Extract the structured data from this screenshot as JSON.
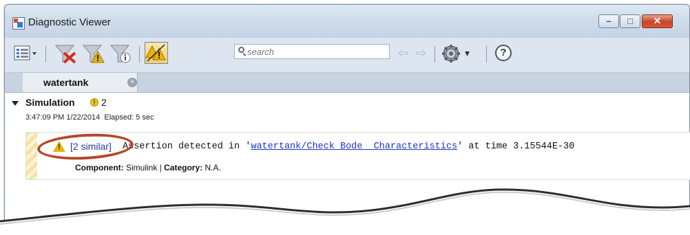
{
  "window": {
    "title": "Diagnostic Viewer",
    "controls": {
      "minimize": "–",
      "maximize": "□",
      "close": "✕"
    }
  },
  "toolbar": {
    "icons": [
      "list-view-icon",
      "clear-filter-icon",
      "filter-warnings-icon",
      "filter-info-icon",
      "group-warnings-icon",
      "settings-icon",
      "help-icon"
    ],
    "search_placeholder": "search",
    "dropdown_glyph": "▾",
    "help_label": "?",
    "nav_back": "⇦",
    "nav_forward": "⇨"
  },
  "tabs": [
    {
      "label": "watertank",
      "close": "×"
    }
  ],
  "simulation": {
    "title": "Simulation",
    "warning_count": "2",
    "warning_glyph": "!",
    "timestamp": "3:47:09 PM 1/22/2014",
    "elapsed": "Elapsed: 5 sec"
  },
  "message": {
    "similar_link": "[2 similar]",
    "text_before": "Assertion detected in '",
    "link_text": "watertank/Check Bode  Characteristics",
    "text_after": "' at time 3.15544E-30",
    "component_label": "Component:",
    "component_value": " Simulink | ",
    "category_label": "Category:",
    "category_value": " N.A."
  },
  "colors": {
    "highlight_oval": "#b5462a",
    "link": "#1a35c8",
    "warning": "#e8b20b"
  }
}
